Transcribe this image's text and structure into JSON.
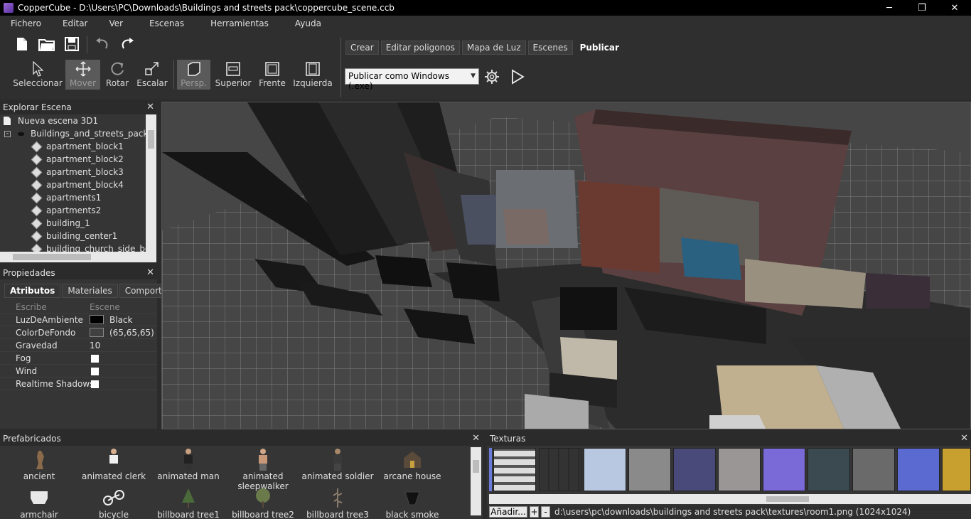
{
  "window": {
    "title": "CopperCube - D:\\Users\\PC\\Downloads\\Buildings and streets pack\\coppercube_scene.ccb",
    "minimize": "─",
    "restore": "❐",
    "close": "✕"
  },
  "menu": [
    "Fichero",
    "Editar",
    "Ver",
    "Escenas",
    "Herramientas",
    "Ayuda"
  ],
  "toolbar": {
    "tools": [
      "Seleccionar",
      "Mover",
      "Rotar",
      "Escalar"
    ],
    "views": [
      "Persp.",
      "Superior",
      "Frente",
      "Izquierda"
    ],
    "tabs": [
      "Crear",
      "Editar poligonos",
      "Mapa de Luz",
      "Escenes",
      "Publicar"
    ],
    "publish_select": "Publicar como Windows (.exe)"
  },
  "scene_explorer": {
    "title": "Explorar Escena",
    "root": "Nueva escena 3D1",
    "group": "Buildings_and_streets_pack",
    "items": [
      "apartment_block1",
      "apartment_block2",
      "apartment_block3",
      "apartment_block4",
      "apartments1",
      "apartments2",
      "building_1",
      "building_center1",
      "building_church_side_bott"
    ]
  },
  "properties": {
    "title": "Propiedades",
    "tabs": [
      "Atributos",
      "Materiales",
      "Comportam"
    ],
    "header_key": "Escribe",
    "header_value": "Escene",
    "rows": [
      {
        "key": "LuzDeAmbiente",
        "value": "Black",
        "swatch": "#000000"
      },
      {
        "key": "ColorDeFondo",
        "value": "(65,65,65)",
        "swatch": "#414141"
      },
      {
        "key": "Gravedad",
        "value": "10"
      },
      {
        "key": "Fog",
        "value": ""
      },
      {
        "key": "Wind",
        "value": ""
      },
      {
        "key": "Realtime Shadows",
        "value": ""
      }
    ]
  },
  "prefabs": {
    "title": "Prefabricados",
    "items": [
      "ancient",
      "animated clerk",
      "animated man",
      "animated sleepwalker",
      "animated soldier",
      "arcane house",
      "armchair",
      "bicycle",
      "billboard tree1",
      "billboard tree2",
      "billboard tree3",
      "black smoke"
    ]
  },
  "textures": {
    "title": "Texturas",
    "add_label": "Añadir...",
    "plus": "+",
    "minus": "-",
    "path": "d:\\users\\pc\\downloads\\buildings and streets pack\\textures\\room1.png (1024x1024)"
  }
}
